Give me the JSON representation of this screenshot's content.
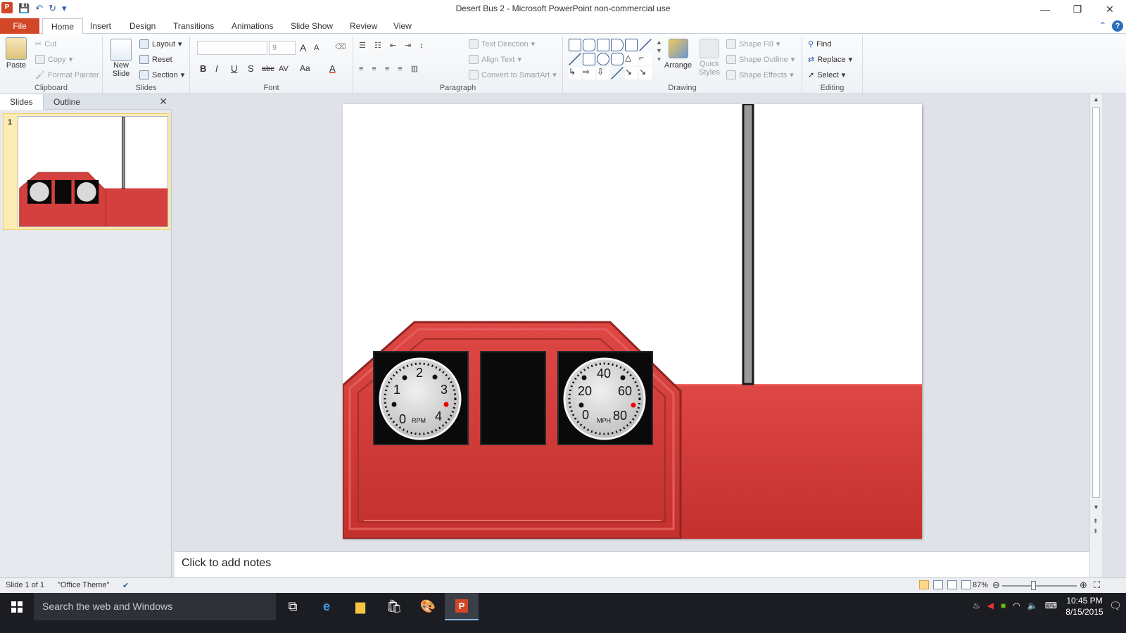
{
  "window": {
    "title": "Desert Bus 2 -  Microsoft PowerPoint non-commercial use",
    "app_icon": "P"
  },
  "tabs": [
    "File",
    "Home",
    "Insert",
    "Design",
    "Transitions",
    "Animations",
    "Slide Show",
    "Review",
    "View"
  ],
  "ribbon": {
    "clipboard": {
      "paste": "Paste",
      "cut": "Cut",
      "copy": "Copy",
      "format_painter": "Format Painter",
      "label": "Clipboard"
    },
    "slides": {
      "new_slide": "New Slide",
      "layout": "Layout",
      "reset": "Reset",
      "section": "Section",
      "label": "Slides"
    },
    "font": {
      "font_name": "",
      "font_size": "9",
      "bold": "B",
      "italic": "I",
      "underline": "U",
      "shadow": "S",
      "strike": "abc",
      "spacing": "AV",
      "case": "Aa",
      "color": "A",
      "grow": "A",
      "shrink": "A",
      "label": "Font"
    },
    "paragraph": {
      "text_direction": "Text Direction",
      "align_text": "Align Text",
      "convert_smartart": "Convert to SmartArt",
      "label": "Paragraph"
    },
    "drawing": {
      "arrange": "Arrange",
      "quick_styles": "Quick Styles",
      "shape_fill": "Shape Fill",
      "shape_outline": "Shape Outline",
      "shape_effects": "Shape Effects",
      "label": "Drawing"
    },
    "editing": {
      "find": "Find",
      "replace": "Replace",
      "select": "Select",
      "label": "Editing"
    }
  },
  "left_pane": {
    "tabs": [
      "Slides",
      "Outline"
    ],
    "slide_number": "1"
  },
  "slide": {
    "rpm_gauge": {
      "labels": [
        "0",
        "1",
        "2",
        "3",
        "4"
      ],
      "unit": "RPM"
    },
    "mph_gauge": {
      "labels": [
        "0",
        "20",
        "40",
        "60",
        "80"
      ],
      "unit": "MPH"
    },
    "colors": {
      "dashboard_red": "#d4403e",
      "gauge_face": "#d9d9d9",
      "screen_black": "#0a0a0a",
      "pole_gray": "#9a9a9a"
    }
  },
  "notes": {
    "placeholder": "Click to add notes"
  },
  "status": {
    "slide_count": "Slide 1 of 1",
    "theme": "\"Office Theme\"",
    "zoom": "87%"
  },
  "taskbar": {
    "search_placeholder": "Search the web and Windows",
    "time": "10:45 PM",
    "date": "8/15/2015"
  }
}
